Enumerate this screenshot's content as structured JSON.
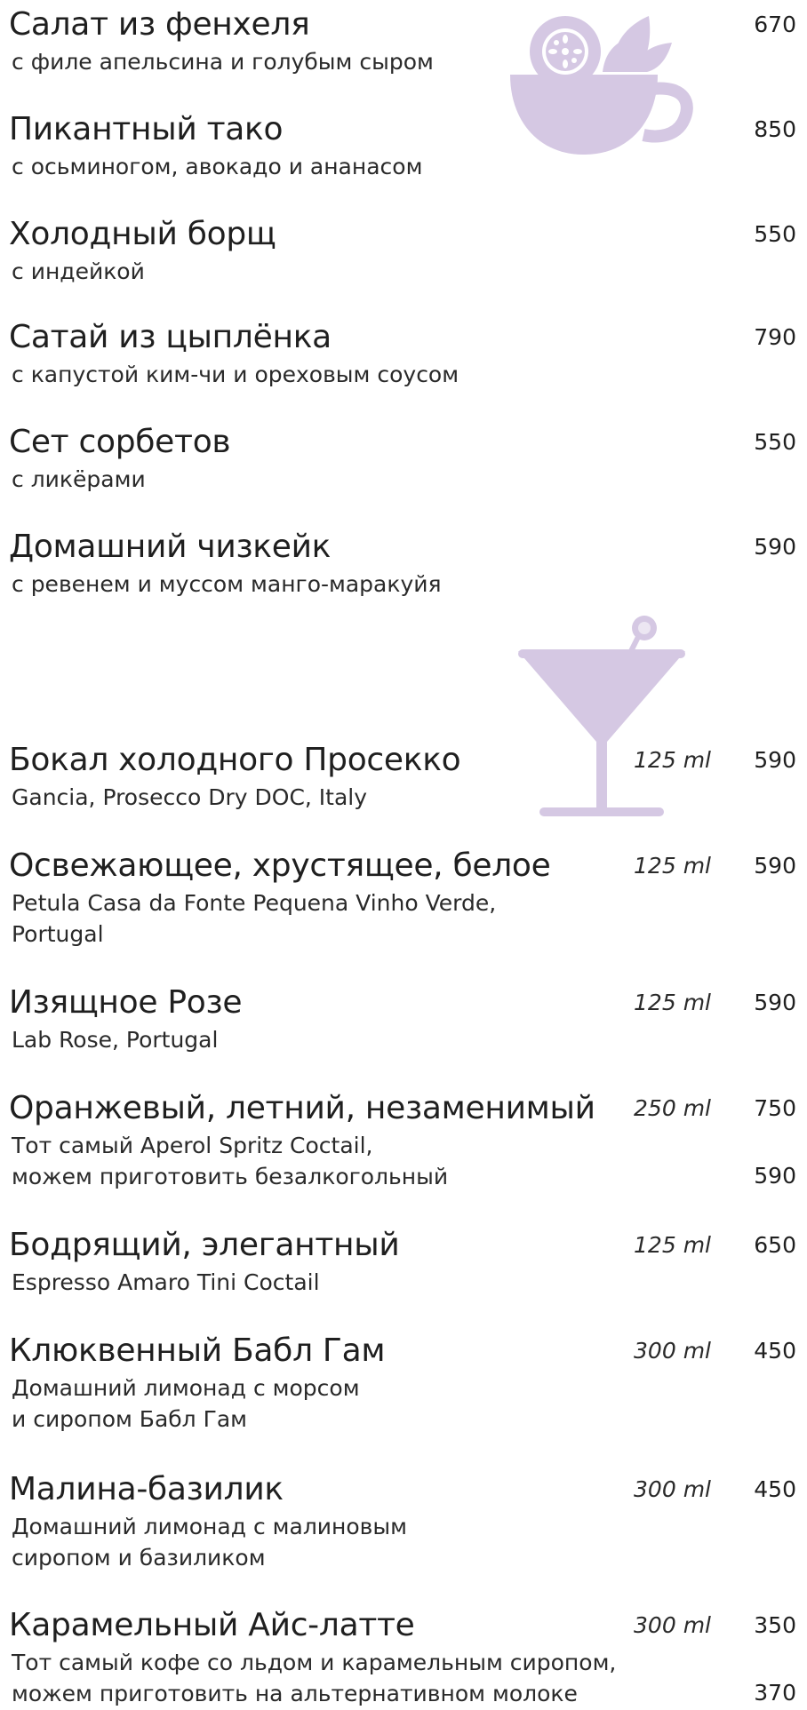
{
  "colors": {
    "text": "#1f1f1f",
    "accent": "#d5c8e3"
  },
  "icons": {
    "salad": "salad-bowl-icon",
    "cocktail": "cocktail-glass-icon"
  },
  "food": [
    {
      "name": "Салат из фенхеля",
      "desc": [
        "с филе апельсина и голубым сыром"
      ],
      "price": "670"
    },
    {
      "name": "Пикантный тако",
      "desc": [
        "с осьминогом, авокадо и ананасом"
      ],
      "price": "850"
    },
    {
      "name": "Холодный борщ",
      "desc": [
        "с индейкой"
      ],
      "price": "550"
    },
    {
      "name": "Сатай из цыплёнка",
      "desc": [
        "с капустой ким-чи и ореховым соусом"
      ],
      "price": "790"
    },
    {
      "name": "Сет сорбетов",
      "desc": [
        "с ликёрами"
      ],
      "price": "550"
    },
    {
      "name": "Домашний чизкейк",
      "desc": [
        "с ревенем и муссом манго-маракуйя"
      ],
      "price": "590"
    }
  ],
  "drinks": [
    {
      "name": "Бокал холодного Просекко",
      "desc": [
        "Gancia, Prosecco Dry DOC, Italy"
      ],
      "volume": "125 ml",
      "price": "590"
    },
    {
      "name": "Освежающее, хрустящее, белое",
      "desc": [
        "Petula Casa da Fonte Pequena Vinho Verde,",
        "Portugal"
      ],
      "volume": "125 ml",
      "price": "590"
    },
    {
      "name": "Изящное Розе",
      "desc": [
        "Lab Rose, Portugal"
      ],
      "volume": "125 ml",
      "price": "590"
    },
    {
      "name": "Оранжевый, летний, незаменимый",
      "desc": [
        "Тот самый Aperol Spritz Coctail,",
        "можем приготовить безалкогольный"
      ],
      "volume": "250 ml",
      "price": "750",
      "price_alt": "590"
    },
    {
      "name": "Бодрящий, элегантный",
      "desc": [
        "Espresso Amaro Tini Coctail"
      ],
      "volume": "125 ml",
      "price": "650"
    },
    {
      "name": "Клюквенный Бабл Гам",
      "desc": [
        "Домашний лимонад с морсом",
        "и сиропом Бабл Гам"
      ],
      "volume": "300 ml",
      "price": "450"
    },
    {
      "name": "Малина-базилик",
      "desc": [
        "Домашний лимонад с малиновым",
        "сиропом и базиликом"
      ],
      "volume": "300 ml",
      "price": "450"
    },
    {
      "name": "Карамельный Айс-латте",
      "desc": [
        "Тот самый кофе со льдом и карамельным сиропом,",
        "можем приготовить на альтернативном молоке"
      ],
      "volume": "300 ml",
      "price": "350",
      "price_alt": "370"
    }
  ]
}
